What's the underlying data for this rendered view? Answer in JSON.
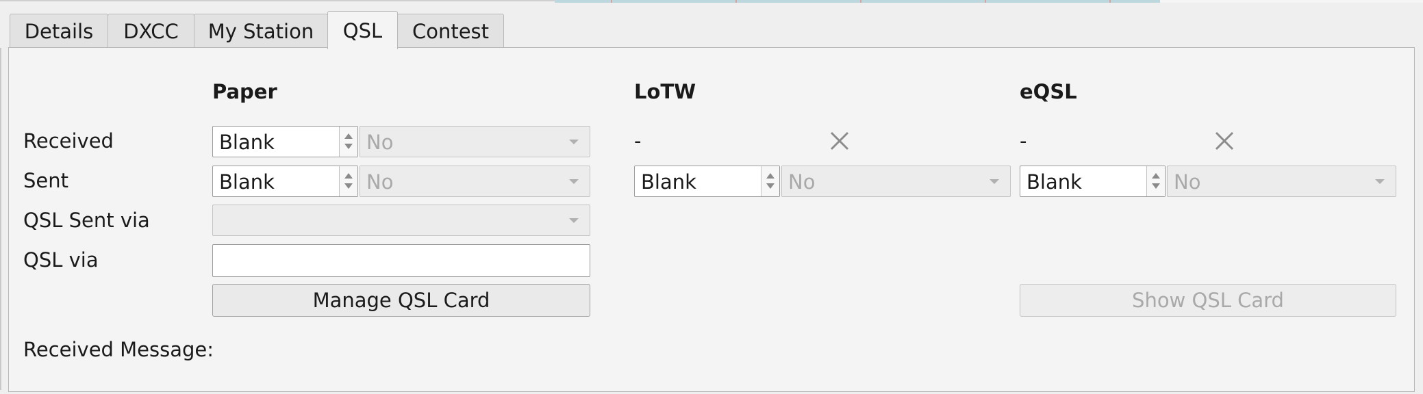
{
  "tabs": [
    {
      "label": "Details",
      "active": false
    },
    {
      "label": "DXCC",
      "active": false
    },
    {
      "label": "My Station",
      "active": false
    },
    {
      "label": "QSL",
      "active": true
    },
    {
      "label": "Contest",
      "active": false
    }
  ],
  "columns": {
    "paper": "Paper",
    "lotw": "LoTW",
    "eqsl": "eQSL"
  },
  "row_labels": {
    "received": "Received",
    "sent": "Sent",
    "qsl_sent_via": "QSL Sent via",
    "qsl_via": "QSL via",
    "received_message": "Received Message:"
  },
  "paper": {
    "received_status": "Blank",
    "received_value": "No",
    "sent_status": "Blank",
    "sent_value": "No",
    "qsl_sent_via": "",
    "qsl_via": "",
    "manage_button": "Manage QSL Card"
  },
  "lotw": {
    "received_value": "-",
    "received_icon": "close-icon",
    "sent_status": "Blank",
    "sent_value": "No"
  },
  "eqsl": {
    "received_value": "-",
    "received_icon": "close-icon",
    "sent_status": "Blank",
    "sent_value": "No",
    "show_button": "Show QSL Card"
  }
}
